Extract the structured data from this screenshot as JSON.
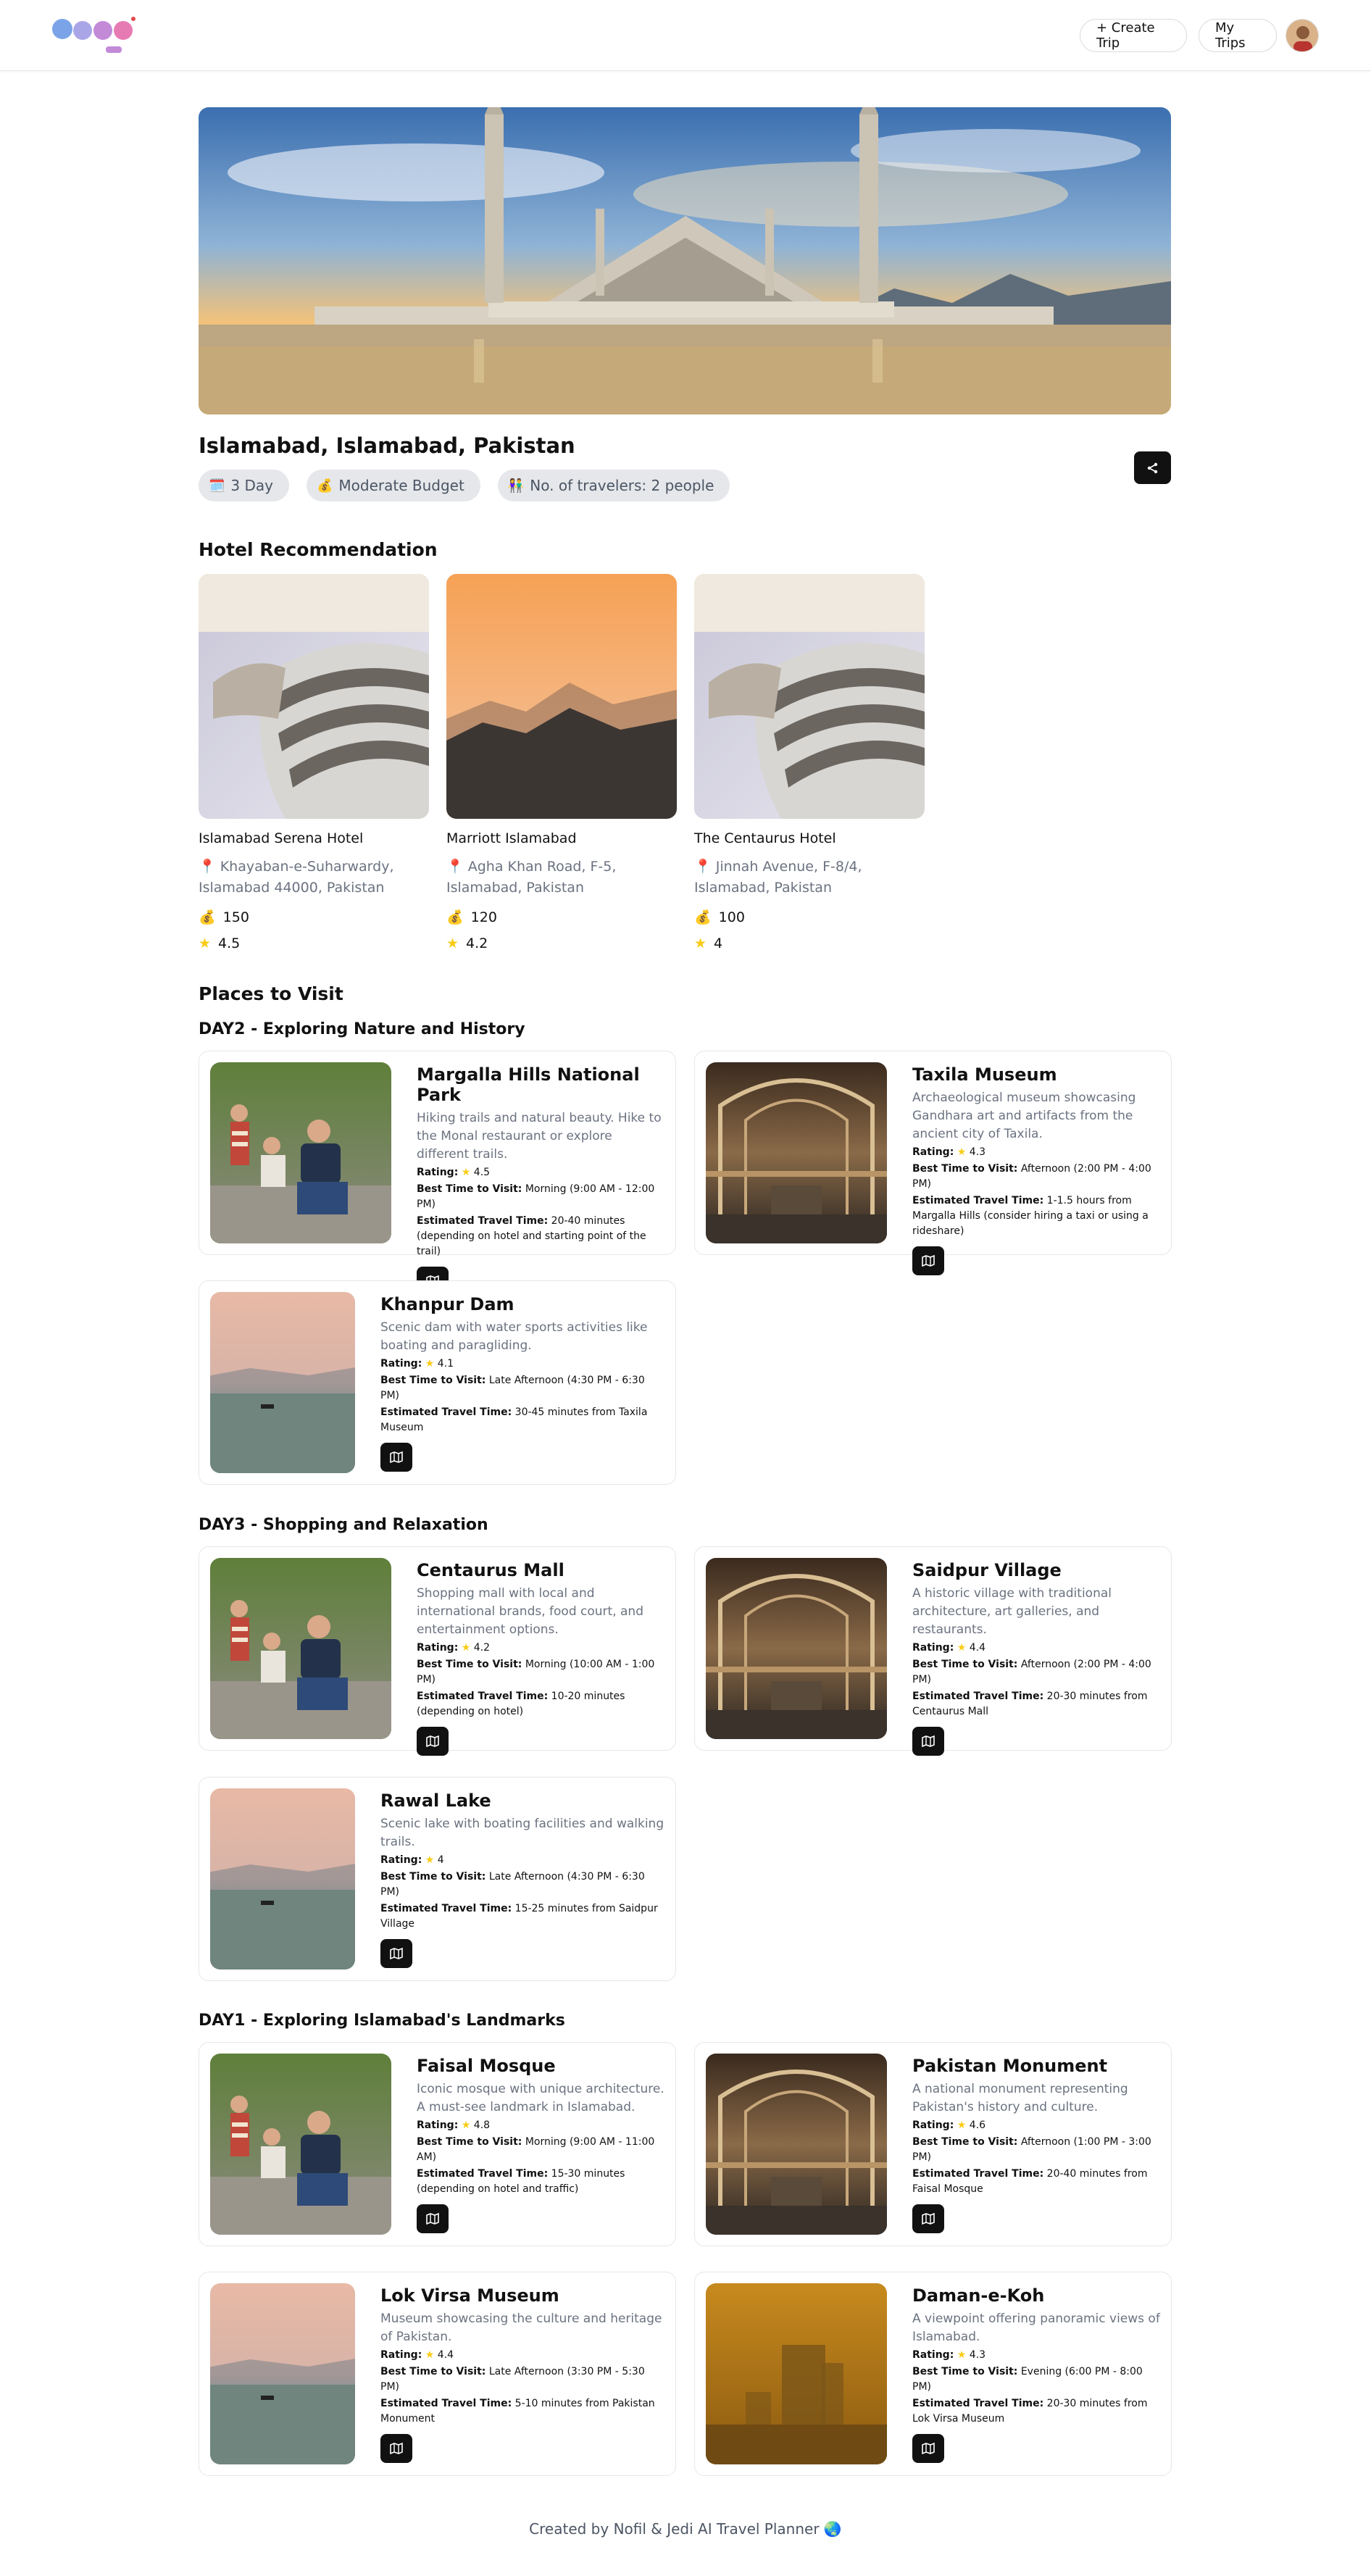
{
  "header": {
    "logo_alt": "Logo",
    "create_trip_label": "+ Create Trip",
    "my_trips_label": "My Trips",
    "avatar_icon": "user-avatar-icon"
  },
  "trip": {
    "location": "Islamabad, Islamabad, Pakistan",
    "chips": [
      {
        "icon": "calendar-icon",
        "emoji": "🗓️",
        "label": "3 Day"
      },
      {
        "icon": "money-bag-icon",
        "emoji": "💰",
        "label": "Moderate Budget"
      },
      {
        "icon": "travelers-icon",
        "emoji": "👫",
        "label": "No. of travelers: 2 people"
      }
    ]
  },
  "hotels": {
    "title": "Hotel Recommendation",
    "items": [
      {
        "name": "Islamabad Serena Hotel",
        "address": "Khayaban-e-Suharwardy, Islamabad 44000, Pakistan",
        "price": "150",
        "rating": "4.5"
      },
      {
        "name": "Marriott Islamabad",
        "address": "Agha Khan Road, F-5, Islamabad, Pakistan",
        "price": "120",
        "rating": "4.2"
      },
      {
        "name": "The Centaurus Hotel",
        "address": "Jinnah Avenue, F-8/4, Islamabad, Pakistan",
        "price": "100",
        "rating": "4"
      }
    ]
  },
  "places": {
    "title": "Places to Visit",
    "labels": {
      "rating": "Rating:",
      "best_time": "Best Time to Visit:",
      "travel_time": "Estimated Travel Time:"
    },
    "days": [
      {
        "title": "DAY2 - Exploring Nature and History",
        "items": [
          {
            "name": "Margalla Hills National Park",
            "desc": "Hiking trails and natural beauty. Hike to the Monal restaurant or explore different trails.",
            "rating": "4.5",
            "best_time": "Morning (9:00 AM - 12:00 PM)",
            "travel_time": "20-40 minutes (depending on hotel and starting point of the trail)"
          },
          {
            "name": "Taxila Museum",
            "desc": "Archaeological museum showcasing Gandhara art and artifacts from the ancient city of Taxila.",
            "rating": "4.3",
            "best_time": "Afternoon (2:00 PM - 4:00 PM)",
            "travel_time": "1-1.5 hours from Margalla Hills (consider hiring a taxi or using a rideshare)"
          },
          {
            "name": "Khanpur Dam",
            "desc": "Scenic dam with water sports activities like boating and paragliding.",
            "rating": "4.1",
            "best_time": "Late Afternoon (4:30 PM - 6:30 PM)",
            "travel_time": "30-45 minutes from Taxila Museum"
          }
        ]
      },
      {
        "title": "DAY3 - Shopping and Relaxation",
        "items": [
          {
            "name": "Centaurus Mall",
            "desc": "Shopping mall with local and international brands, food court, and entertainment options.",
            "rating": "4.2",
            "best_time": "Morning (10:00 AM - 1:00 PM)",
            "travel_time": "10-20 minutes (depending on hotel)"
          },
          {
            "name": "Saidpur Village",
            "desc": "A historic village with traditional architecture, art galleries, and restaurants.",
            "rating": "4.4",
            "best_time": "Afternoon (2:00 PM - 4:00 PM)",
            "travel_time": "20-30 minutes from Centaurus Mall"
          },
          {
            "name": "Rawal Lake",
            "desc": "Scenic lake with boating facilities and walking trails.",
            "rating": "4",
            "best_time": "Late Afternoon (4:30 PM - 6:30 PM)",
            "travel_time": "15-25 minutes from Saidpur Village"
          }
        ]
      },
      {
        "title": "DAY1 - Exploring Islamabad's Landmarks",
        "items": [
          {
            "name": "Faisal Mosque",
            "desc": "Iconic mosque with unique architecture. A must-see landmark in Islamabad.",
            "rating": "4.8",
            "best_time": "Morning (9:00 AM - 11:00 AM)",
            "travel_time": "15-30 minutes (depending on hotel and traffic)"
          },
          {
            "name": "Pakistan Monument",
            "desc": "A national monument representing Pakistan's history and culture.",
            "rating": "4.6",
            "best_time": "Afternoon (1:00 PM - 3:00 PM)",
            "travel_time": "20-40 minutes from Faisal Mosque"
          },
          {
            "name": "Lok Virsa Museum",
            "desc": "Museum showcasing the culture and heritage of Pakistan.",
            "rating": "4.4",
            "best_time": "Late Afternoon (3:30 PM - 5:30 PM)",
            "travel_time": "5-10 minutes from Pakistan Monument"
          },
          {
            "name": "Daman-e-Koh",
            "desc": "A viewpoint offering panoramic views of Islamabad.",
            "rating": "4.3",
            "best_time": "Evening (6:00 PM - 8:00 PM)",
            "travel_time": "20-30 minutes from Lok Virsa Museum"
          }
        ]
      }
    ]
  },
  "footer": {
    "text": "Created by Nofil & Jedi AI Travel Planner"
  },
  "colors": {
    "accent_dark": "#111111",
    "chip_bg": "#e5e7eb",
    "muted_text": "#6b7280",
    "star": "#facc15",
    "pin": "#db2777"
  }
}
